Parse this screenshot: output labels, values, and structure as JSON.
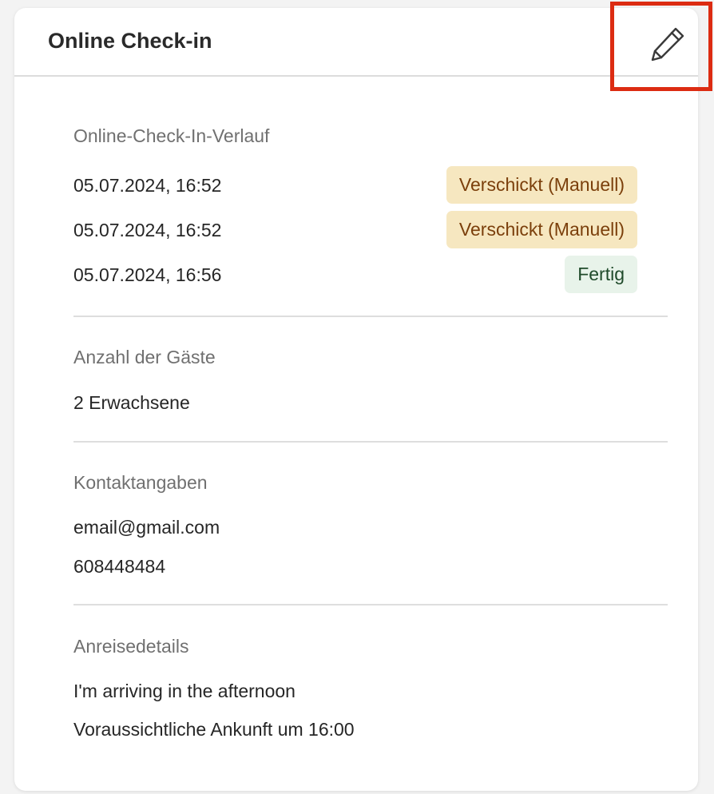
{
  "card": {
    "title": "Online Check-in",
    "edit_icon": "pencil-icon"
  },
  "history": {
    "label": "Online-Check-In-Verlauf",
    "entries": [
      {
        "timestamp": "05.07.2024, 16:52",
        "status": "Verschickt (Manuell)",
        "status_type": "sent"
      },
      {
        "timestamp": "05.07.2024, 16:52",
        "status": "Verschickt (Manuell)",
        "status_type": "sent"
      },
      {
        "timestamp": "05.07.2024, 16:56",
        "status": "Fertig",
        "status_type": "done"
      }
    ]
  },
  "guests": {
    "label": "Anzahl der Gäste",
    "value": "2 Erwachsene"
  },
  "contact": {
    "label": "Kontaktangaben",
    "email": "email@gmail.com",
    "phone": "608448484"
  },
  "arrival": {
    "label": "Anreisedetails",
    "note": "I'm arriving in the afternoon",
    "eta": "Voraussichtliche Ankunft um 16:00"
  },
  "colors": {
    "highlight_border": "#dc2c12",
    "badge_sent_bg": "#f6e7c0",
    "badge_sent_text": "#7b3f0b",
    "badge_done_bg": "#e8f3ea",
    "badge_done_text": "#1f4a2a"
  }
}
